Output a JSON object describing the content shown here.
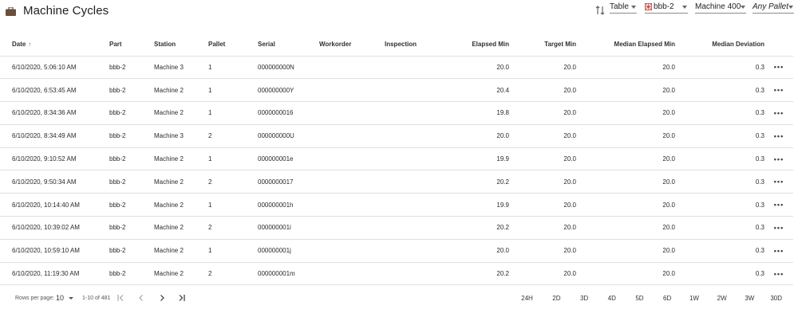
{
  "header": {
    "title": "Machine Cycles",
    "title_icon": "briefcase-icon",
    "sort_icon": "swap-vertical-icon",
    "type_select": "Table",
    "part_select": "bbb-2",
    "machine_select": "Machine 400",
    "pallet_select": "Any Pallet"
  },
  "table": {
    "columns": {
      "date": "Date",
      "part": "Part",
      "station": "Station",
      "pallet": "Pallet",
      "serial": "Serial",
      "workorder": "Workorder",
      "inspection": "Inspection",
      "elapsed": "Elapsed Min",
      "target": "Target Min",
      "median_elapsed": "Median Elapsed Min",
      "median_dev": "Median Deviation"
    },
    "sort_icon": "arrow-up-icon",
    "row_action_icon": "more-horizontal-icon",
    "rows": [
      {
        "date": "6/10/2020, 5:06:10 AM",
        "part": "bbb-2",
        "station": "Machine 3",
        "pallet": "1",
        "serial": "000000000N",
        "workorder": "",
        "inspection": "",
        "elapsed": "20.0",
        "target": "20.0",
        "median_elapsed": "20.0",
        "median_dev": "0.3"
      },
      {
        "date": "6/10/2020, 6:53:45 AM",
        "part": "bbb-2",
        "station": "Machine 2",
        "pallet": "1",
        "serial": "000000000Y",
        "workorder": "",
        "inspection": "",
        "elapsed": "20.4",
        "target": "20.0",
        "median_elapsed": "20.0",
        "median_dev": "0.3"
      },
      {
        "date": "6/10/2020, 8:34:36 AM",
        "part": "bbb-2",
        "station": "Machine 2",
        "pallet": "1",
        "serial": "0000000016",
        "workorder": "",
        "inspection": "",
        "elapsed": "19.8",
        "target": "20.0",
        "median_elapsed": "20.0",
        "median_dev": "0.3"
      },
      {
        "date": "6/10/2020, 8:34:49 AM",
        "part": "bbb-2",
        "station": "Machine 3",
        "pallet": "2",
        "serial": "000000000U",
        "workorder": "",
        "inspection": "",
        "elapsed": "20.0",
        "target": "20.0",
        "median_elapsed": "20.0",
        "median_dev": "0.3"
      },
      {
        "date": "6/10/2020, 9:10:52 AM",
        "part": "bbb-2",
        "station": "Machine 2",
        "pallet": "1",
        "serial": "000000001e",
        "workorder": "",
        "inspection": "",
        "elapsed": "19.9",
        "target": "20.0",
        "median_elapsed": "20.0",
        "median_dev": "0.3"
      },
      {
        "date": "6/10/2020, 9:50:34 AM",
        "part": "bbb-2",
        "station": "Machine 2",
        "pallet": "2",
        "serial": "0000000017",
        "workorder": "",
        "inspection": "",
        "elapsed": "20.2",
        "target": "20.0",
        "median_elapsed": "20.0",
        "median_dev": "0.3"
      },
      {
        "date": "6/10/2020, 10:14:40 AM",
        "part": "bbb-2",
        "station": "Machine 2",
        "pallet": "1",
        "serial": "000000001h",
        "workorder": "",
        "inspection": "",
        "elapsed": "19.9",
        "target": "20.0",
        "median_elapsed": "20.0",
        "median_dev": "0.3"
      },
      {
        "date": "6/10/2020, 10:39:02 AM",
        "part": "bbb-2",
        "station": "Machine 2",
        "pallet": "2",
        "serial": "000000001i",
        "workorder": "",
        "inspection": "",
        "elapsed": "20.2",
        "target": "20.0",
        "median_elapsed": "20.0",
        "median_dev": "0.3"
      },
      {
        "date": "6/10/2020, 10:59:10 AM",
        "part": "bbb-2",
        "station": "Machine 2",
        "pallet": "1",
        "serial": "000000001j",
        "workorder": "",
        "inspection": "",
        "elapsed": "20.0",
        "target": "20.0",
        "median_elapsed": "20.0",
        "median_dev": "0.3"
      },
      {
        "date": "6/10/2020, 11:19:30 AM",
        "part": "bbb-2",
        "station": "Machine 2",
        "pallet": "2",
        "serial": "000000001m",
        "workorder": "",
        "inspection": "",
        "elapsed": "20.2",
        "target": "20.0",
        "median_elapsed": "20.0",
        "median_dev": "0.3"
      }
    ]
  },
  "footer": {
    "rows_per_page_label": "Rows per page:",
    "rows_per_page_value": "10",
    "range_text": "1-10 of 481",
    "range_buttons": [
      "24H",
      "2D",
      "3D",
      "4D",
      "5D",
      "6D",
      "1W",
      "2W",
      "3W",
      "30D"
    ]
  }
}
